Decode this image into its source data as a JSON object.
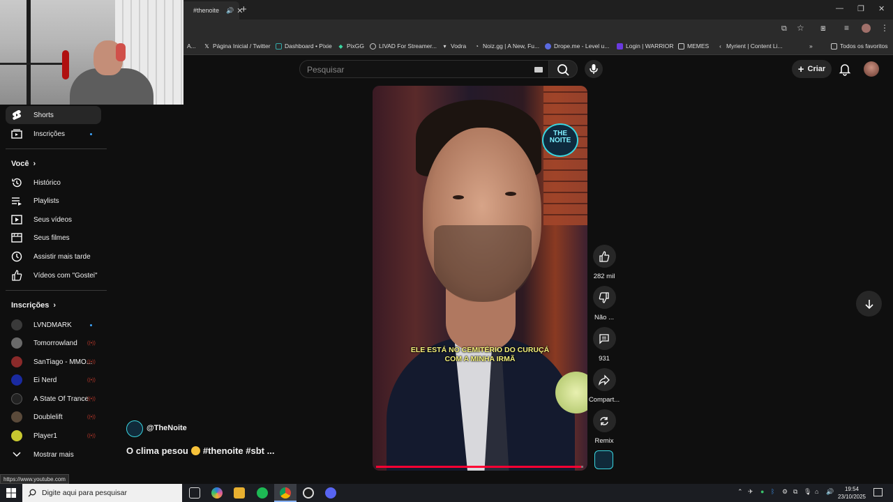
{
  "browser": {
    "active_tab_title": "#thenoite",
    "bookmarks": [
      {
        "label": "A...",
        "icon": "page-icon"
      },
      {
        "label": "Página Inicial / Twitter",
        "icon": "x-logo-icon"
      },
      {
        "label": "Dashboard • Pixie",
        "icon": "pixie-icon"
      },
      {
        "label": "PixGG",
        "icon": "pixgg-icon"
      },
      {
        "label": "LIVAD For Streamer...",
        "icon": "livad-icon"
      },
      {
        "label": "Vodra",
        "icon": "vodra-icon"
      },
      {
        "label": "Noiz.gg | A New, Fu...",
        "icon": "noiz-icon"
      },
      {
        "label": "Drope.me - Level u...",
        "icon": "drope-icon"
      },
      {
        "label": "Login | WARRIOR",
        "icon": "warrior-icon"
      },
      {
        "label": "MEMES",
        "icon": "folder-icon"
      },
      {
        "label": "Myrient | Content Li...",
        "icon": "myrient-icon"
      },
      {
        "label": "Todos os favoritos",
        "icon": "folder-icon"
      }
    ],
    "status_url": "https://www.youtube.com"
  },
  "header": {
    "search_placeholder": "Pesquisar",
    "create_label": "Criar"
  },
  "sidebar": {
    "top": [
      {
        "label": "Shorts",
        "icon": "shorts-icon",
        "active": true
      },
      {
        "label": "Inscrições",
        "icon": "subscriptions-icon",
        "dot": true
      }
    ],
    "you_heading": "Você",
    "you_items": [
      {
        "label": "Histórico",
        "icon": "history-icon"
      },
      {
        "label": "Playlists",
        "icon": "playlists-icon"
      },
      {
        "label": "Seus vídeos",
        "icon": "your-videos-icon"
      },
      {
        "label": "Seus filmes",
        "icon": "your-movies-icon"
      },
      {
        "label": "Assistir mais tarde",
        "icon": "watch-later-icon"
      },
      {
        "label": "Vídeos com \"Gostei\"",
        "icon": "liked-videos-icon"
      }
    ],
    "subs_heading": "Inscrições",
    "subs": [
      {
        "label": "LVNDMARK",
        "status": "dot",
        "color": "#3a3a3a"
      },
      {
        "label": "Tomorrowland",
        "status": "live",
        "color": "#6a6a6a"
      },
      {
        "label": "SanTiago - MMO...",
        "status": "live",
        "color": "#8a2a2a"
      },
      {
        "label": "Ei Nerd",
        "status": "live",
        "color": "#1a2aa0"
      },
      {
        "label": "A State Of Trance",
        "status": "live",
        "color": "#222222"
      },
      {
        "label": "Doublelift",
        "status": "live",
        "color": "#5a4a3a"
      },
      {
        "label": "Player1",
        "status": "live",
        "color": "#c8c830"
      }
    ],
    "show_more": "Mostrar mais"
  },
  "video": {
    "subtitle_line1": "ELE ESTÁ NO CEMITÉRIO DO CURUÇÁ",
    "subtitle_line2": "COM A MINHA IRMÃ",
    "overlay_logo": "THE NOITE",
    "progress_fraction": 0.99,
    "channel": "@TheNoite",
    "title_part1": "O clima pesou",
    "title_part2": "#thenoite #sbt ..."
  },
  "actions": {
    "like_count": "282 mil",
    "dislike_label": "Não ...",
    "comments_count": "931",
    "share_label": "Compart...",
    "remix_label": "Remix"
  },
  "taskbar": {
    "search_placeholder": "Digite aqui para pesquisar",
    "time": "19:54",
    "date": "23/10/2025"
  },
  "colors": {
    "accent_red": "#ff0033",
    "dot_blue": "#3ea6ff"
  }
}
